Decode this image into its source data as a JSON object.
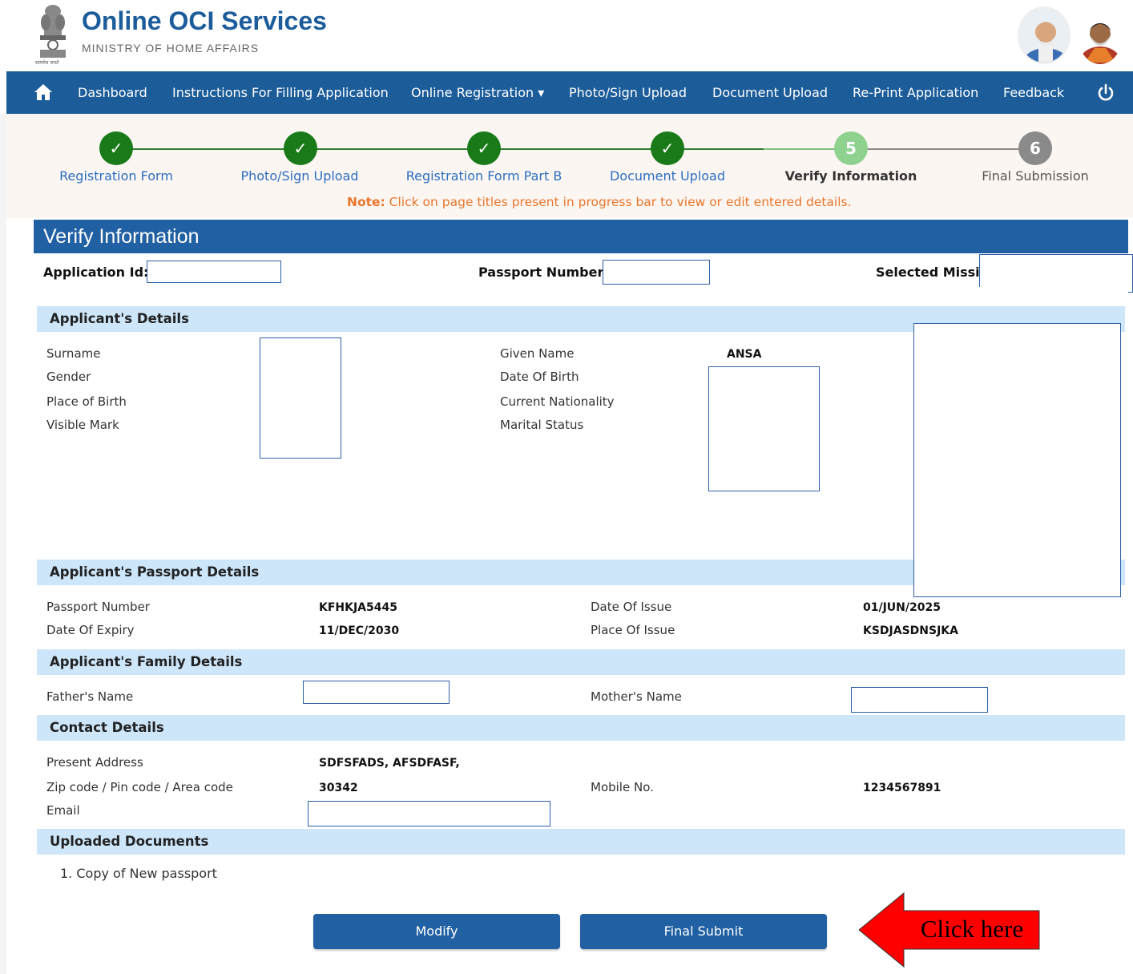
{
  "header": {
    "title": "Online OCI Services",
    "subtitle": "MINISTRY OF HOME AFFAIRS",
    "emblem_icon": "national-emblem",
    "emblem_caption": "सत्यमेव जयते"
  },
  "nav": {
    "home_icon": "home-icon",
    "items": [
      {
        "label": "Dashboard"
      },
      {
        "label": "Instructions For Filling Application"
      },
      {
        "label": "Online Registration ▾"
      },
      {
        "label": "Photo/Sign Upload"
      },
      {
        "label": "Document Upload"
      },
      {
        "label": "Re-Print Application"
      },
      {
        "label": "Feedback"
      }
    ],
    "power_icon": "power-icon"
  },
  "progress": {
    "steps": [
      {
        "marker": "✓",
        "label": "Registration Form",
        "state": "done"
      },
      {
        "marker": "✓",
        "label": "Photo/Sign Upload",
        "state": "done"
      },
      {
        "marker": "✓",
        "label": "Registration Form Part B",
        "state": "done"
      },
      {
        "marker": "✓",
        "label": "Document Upload",
        "state": "done"
      },
      {
        "marker": "5",
        "label": "Verify Information",
        "state": "current"
      },
      {
        "marker": "6",
        "label": "Final Submission",
        "state": "pending"
      }
    ],
    "note_prefix": "Note:",
    "note_text": " Click on page titles present in progress bar to view or edit entered details."
  },
  "panel": {
    "title": "Verify Information",
    "application_id_label": "Application Id:",
    "passport_number_label": "Passport Number:",
    "selected_mission_label": "Selected Missio"
  },
  "applicant": {
    "heading": "Applicant's Details",
    "surname_label": "Surname",
    "gender_label": "Gender",
    "place_of_birth_label": "Place of Birth",
    "visible_mark_label": "Visible Mark",
    "given_name_label": "Given Name",
    "given_name_value": "ANSA",
    "dob_label": "Date Of Birth",
    "nationality_label": "Current Nationality",
    "marital_label": "Marital Status"
  },
  "passport": {
    "heading": "Applicant's Passport Details",
    "number_label": "Passport Number",
    "number_value": "KFHKJA5445",
    "issue_label": "Date Of Issue",
    "issue_value": "01/JUN/2025",
    "expiry_label": "Date Of Expiry",
    "expiry_value": "11/DEC/2030",
    "place_label": "Place Of Issue",
    "place_value": "KSDJASDNSJKA"
  },
  "family": {
    "heading": "Applicant's Family Details",
    "father_label": "Father's Name",
    "mother_label": "Mother's Name"
  },
  "contact": {
    "heading": "Contact Details",
    "address_label": "Present Address",
    "address_value": "SDFSFADS, AFSDFASF,",
    "zip_label": "Zip code / Pin code / Area code",
    "zip_value": "30342",
    "mobile_label": "Mobile No.",
    "mobile_value": "1234567891",
    "email_label": "Email"
  },
  "documents": {
    "heading": "Uploaded Documents",
    "items": [
      "1. Copy of New passport"
    ]
  },
  "actions": {
    "modify_label": "Modify",
    "submit_label": "Final Submit"
  },
  "callout": {
    "text": "Click here",
    "color": "#ff0000"
  },
  "colors": {
    "brand_blue": "#1b5c99",
    "step_done": "#1a7a1a",
    "step_current": "#8fd28f",
    "step_pending": "#8a8a8a",
    "section_head": "#cde6fa",
    "note": "#e8762a"
  }
}
